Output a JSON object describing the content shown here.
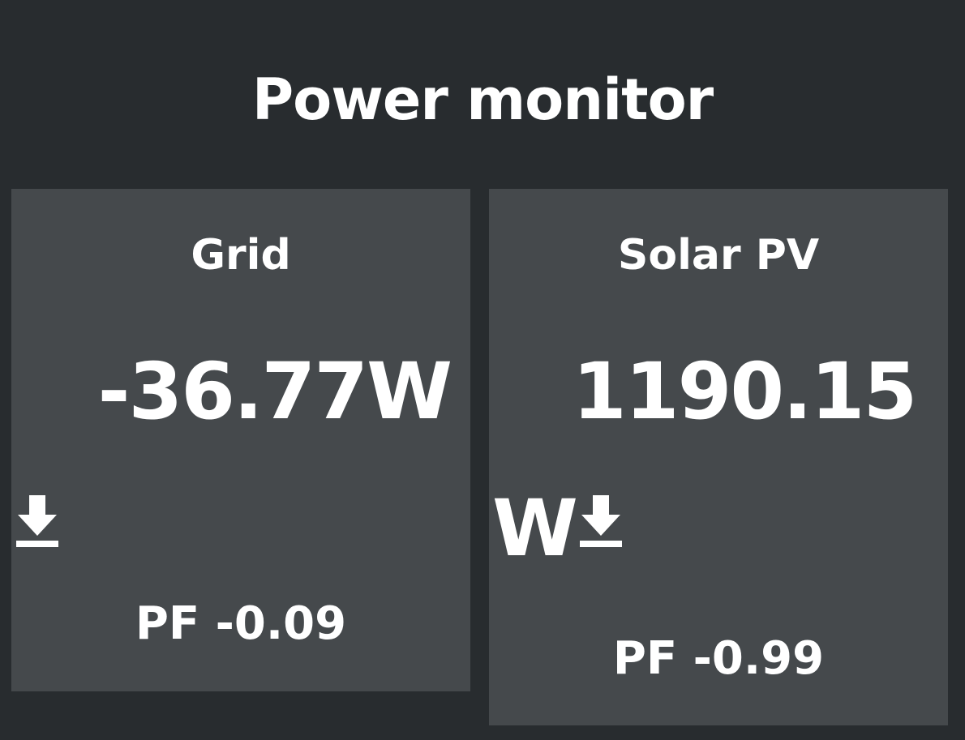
{
  "header": {
    "title": "Power monitor"
  },
  "cards": {
    "grid": {
      "title": "Grid",
      "value": "-36.77W",
      "pf": "PF -0.09",
      "icon": "download-arrow-icon"
    },
    "solar": {
      "title": "Solar PV",
      "value_line1": "1190.15",
      "value_line2": "W",
      "pf": "PF -0.99",
      "icon": "download-arrow-icon"
    }
  },
  "colors": {
    "background": "#282c2f",
    "card": "#45494c",
    "text": "#ffffff"
  }
}
